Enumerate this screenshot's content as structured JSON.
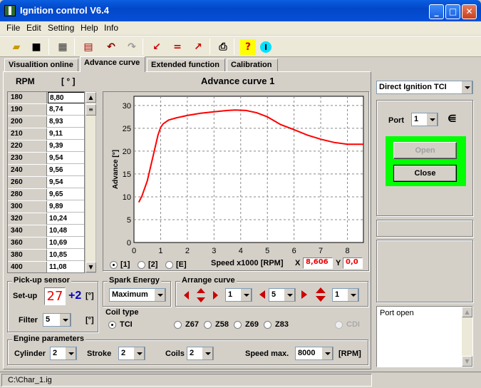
{
  "window": {
    "title": "Ignition control V6.4",
    "min": "_",
    "max": "□",
    "close": "✕"
  },
  "menu": [
    "File",
    "Edit",
    "Setting",
    "Help",
    "Info"
  ],
  "tabs": [
    "Visualition online",
    "Advance curve",
    "Extended function",
    "Calibration"
  ],
  "table": {
    "col_rpm": "RPM",
    "col_deg": "[ ° ]",
    "rows": [
      [
        "180",
        "8,80"
      ],
      [
        "190",
        "8,74"
      ],
      [
        "200",
        "8,93"
      ],
      [
        "210",
        "9,11"
      ],
      [
        "220",
        "9,39"
      ],
      [
        "230",
        "9,54"
      ],
      [
        "240",
        "9,56"
      ],
      [
        "260",
        "9,54"
      ],
      [
        "280",
        "9,65"
      ],
      [
        "300",
        "9,89"
      ],
      [
        "320",
        "10,24"
      ],
      [
        "340",
        "10,48"
      ],
      [
        "360",
        "10,69"
      ],
      [
        "380",
        "10,85"
      ],
      [
        "400",
        "11,08"
      ]
    ]
  },
  "chart_data": {
    "type": "line",
    "title": "Advance curve 1",
    "xlabel": "Speed x1000 [RPM]",
    "ylabel": "Advance [°]",
    "xlim": [
      0,
      8.6
    ],
    "ylim": [
      0,
      32
    ],
    "xticks": [
      "0",
      "1",
      "2",
      "3",
      "4",
      "5",
      "6",
      "7",
      "8"
    ],
    "yticks": [
      "0",
      "5",
      "10",
      "15",
      "20",
      "25",
      "30"
    ],
    "grid": true,
    "series": [
      {
        "color": "#ff0000",
        "x": [
          0.18,
          0.3,
          0.5,
          0.7,
          0.9,
          1.0,
          1.1,
          1.3,
          1.6,
          2.0,
          2.5,
          3.0,
          3.5,
          3.8,
          4.2,
          4.6,
          5.0,
          5.5,
          6.0,
          6.5,
          7.0,
          7.5,
          8.0,
          8.5,
          8.6
        ],
        "y": [
          8.8,
          10.2,
          13.5,
          18.5,
          23.5,
          25.2,
          26.0,
          26.8,
          27.3,
          27.8,
          28.3,
          28.6,
          28.9,
          29.0,
          28.9,
          28.4,
          27.5,
          25.8,
          24.7,
          23.5,
          22.6,
          21.9,
          21.5,
          21.5,
          21.5
        ]
      }
    ]
  },
  "curve_select": {
    "opt1": "[1]",
    "opt2": "[2]",
    "opt3": "[E]"
  },
  "readout": {
    "speed_label": "Speed x1000 [RPM]",
    "x_label": "X",
    "x_value": "8,606",
    "y_label": "Y",
    "y_value": "0,0"
  },
  "pickup": {
    "title": "Pick-up sensor",
    "setup_label": "Set-up",
    "setup_value": "27",
    "offset": "+2",
    "unit": "[°]",
    "filter_label": "Filter",
    "filter_value": "5",
    "filter_unit": "[°]"
  },
  "spark": {
    "title": "Spark Energy",
    "value": "Maximum"
  },
  "arrange": {
    "title": "Arrange curve",
    "v1": "1",
    "v2": "5",
    "v3": "1"
  },
  "coil": {
    "title": "Coil type",
    "options": [
      "TCI",
      "Z67",
      "Z58",
      "Z69",
      "Z83",
      "CDI"
    ]
  },
  "engine": {
    "title": "Engine parameters",
    "cyl_label": "Cylinder",
    "cyl": "2",
    "stroke_label": "Stroke",
    "stroke": "2",
    "coils_label": "Coils",
    "coils": "2",
    "speed_label": "Speed max.",
    "speed": "8000",
    "unit": "[RPM]"
  },
  "right": {
    "mode": "Direct Ignition TCI",
    "port_label": "Port",
    "port": "1",
    "open": "Open",
    "close": "Close",
    "log": "Port open"
  },
  "status": "C:\\Char_1.ig",
  "colors": {
    "titlebar": "#0550d8",
    "curve": "#ff0000",
    "connect_frame": "#00ff00"
  }
}
